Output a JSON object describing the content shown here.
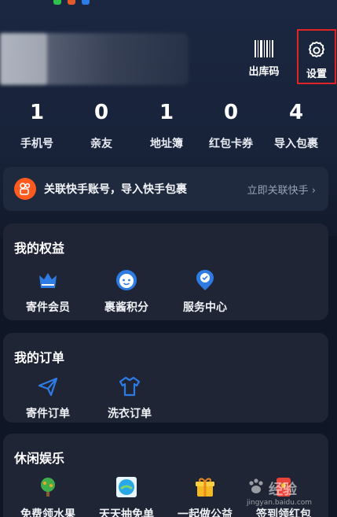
{
  "header": {
    "barcode_label": "出库码",
    "settings_label": "设置"
  },
  "stats": [
    {
      "value": "1",
      "label": "手机号"
    },
    {
      "value": "0",
      "label": "亲友"
    },
    {
      "value": "1",
      "label": "地址簿"
    },
    {
      "value": "0",
      "label": "红包卡券"
    },
    {
      "value": "4",
      "label": "导入包裹"
    }
  ],
  "banner": {
    "text": "关联快手账号，导入快手包裹",
    "link": "立即关联快手 ›"
  },
  "benefits": {
    "title": "我的权益",
    "items": [
      {
        "label": "寄件会员",
        "icon": "crown-icon"
      },
      {
        "label": "裹酱积分",
        "icon": "mascot-icon"
      },
      {
        "label": "服务中心",
        "icon": "badge-icon"
      }
    ]
  },
  "orders": {
    "title": "我的订单",
    "items": [
      {
        "label": "寄件订单",
        "icon": "send-icon"
      },
      {
        "label": "洗衣订单",
        "icon": "shirt-icon"
      }
    ]
  },
  "leisure": {
    "title": "休闲娱乐",
    "items": [
      {
        "label": "免费领水果",
        "icon": "fruit-tree-icon"
      },
      {
        "label": "天天抽免单",
        "icon": "lottery-icon"
      },
      {
        "label": "一起做公益",
        "icon": "gift-icon"
      },
      {
        "label": "签到领红包",
        "icon": "red-packet-icon"
      }
    ]
  },
  "watermark": {
    "big": "经验",
    "small": "jingyan.baidu.com"
  },
  "colors": {
    "background": "#0f1626",
    "card": "#1f2535",
    "accent_blue": "#2f7be4",
    "highlight_red": "#e02424",
    "kuaishou_orange": "#ff5a1f"
  }
}
